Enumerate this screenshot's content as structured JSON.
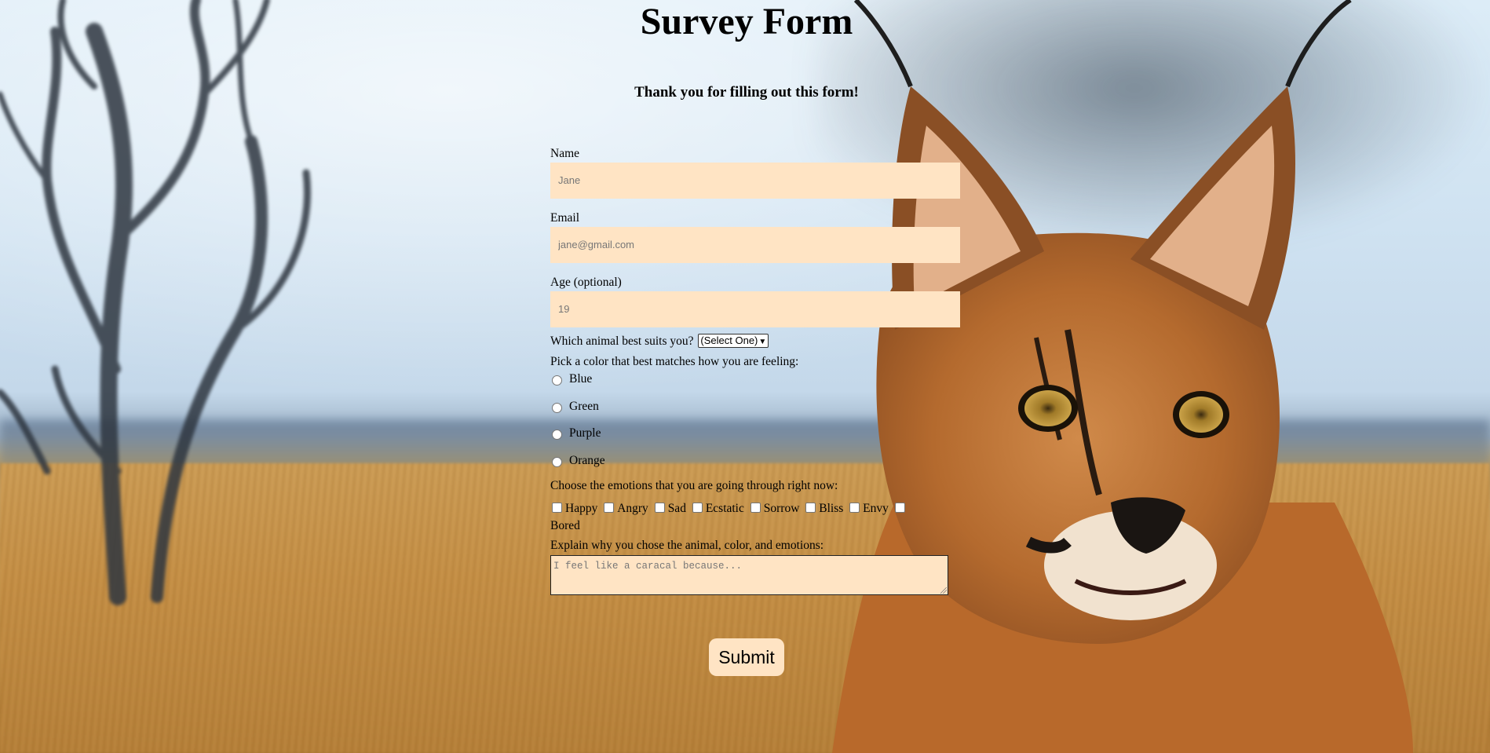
{
  "page": {
    "title": "Survey Form",
    "subtitle": "Thank you for filling out this form!"
  },
  "form": {
    "name": {
      "label": "Name",
      "placeholder": "Jane"
    },
    "email": {
      "label": "Email",
      "placeholder": "jane@gmail.com"
    },
    "age": {
      "label": "Age (optional)",
      "placeholder": "19"
    },
    "animal": {
      "label": "Which animal best suits you?",
      "selected": "(Select One)"
    },
    "color": {
      "label": "Pick a color that best matches how you are feeling:",
      "options": [
        "Blue",
        "Green",
        "Purple",
        "Orange"
      ]
    },
    "emotions": {
      "label": "Choose the emotions that you are going through right now:",
      "options": [
        "Happy",
        "Angry",
        "Sad",
        "Ecstatic",
        "Sorrow",
        "Bliss",
        "Envy",
        "Bored"
      ]
    },
    "explain": {
      "label": "Explain why you chose the animal, color, and emotions:",
      "placeholder": "I feel like a caracal because..."
    },
    "submit_label": "Submit"
  },
  "theme": {
    "input_background": "#ffe4c4",
    "text_color": "#000000"
  }
}
